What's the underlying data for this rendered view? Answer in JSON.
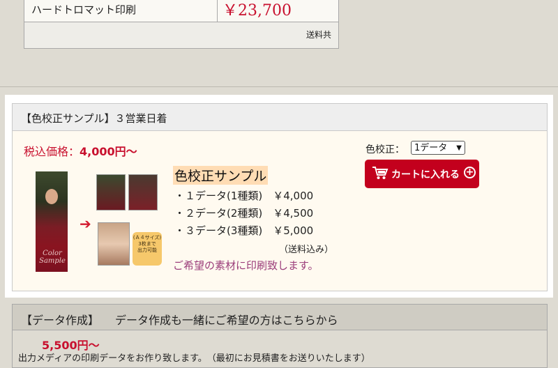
{
  "top": {
    "item": "ハードトロマット印刷",
    "price": "￥23,700",
    "shipping": "送料共"
  },
  "sample": {
    "title": "【色校正サンプル】３営業日着",
    "price_label": "税込価格：",
    "price_value": "4,000円〜",
    "select_label": "色校正：",
    "select_value": "1データ",
    "cart_button": "カートに入れる",
    "product_name": "色校正サンプル",
    "options": [
      "・１データ(1種類)　￥4,000",
      "・２データ(2種類)　￥4,500",
      "・３データ(3種類)　￥5,000"
    ],
    "shipping_note": "（送料込み）",
    "note": "ご希望の素材に印刷致します。",
    "poster_text": "Color Sample",
    "badge_text": "(Ａ４サイズ)\n3枚まで\n出力可能"
  },
  "data_creation": {
    "title": "【データ作成】",
    "subtitle": "データ作成も一緒にご希望の方はこちらから",
    "price": "5,500円〜",
    "text": "出力メディアの印刷データをお作り致します。　（最初にお見積書をお送りいたします）"
  },
  "icons": {
    "cart": "cart-icon",
    "plus": "plus-circle-icon",
    "arrow": "arrow-right-icon"
  },
  "colors": {
    "accent_red": "#c3001d",
    "price_red": "#c8102e",
    "note_purple": "#9b3d7a",
    "highlight": "#ffdcb4"
  }
}
